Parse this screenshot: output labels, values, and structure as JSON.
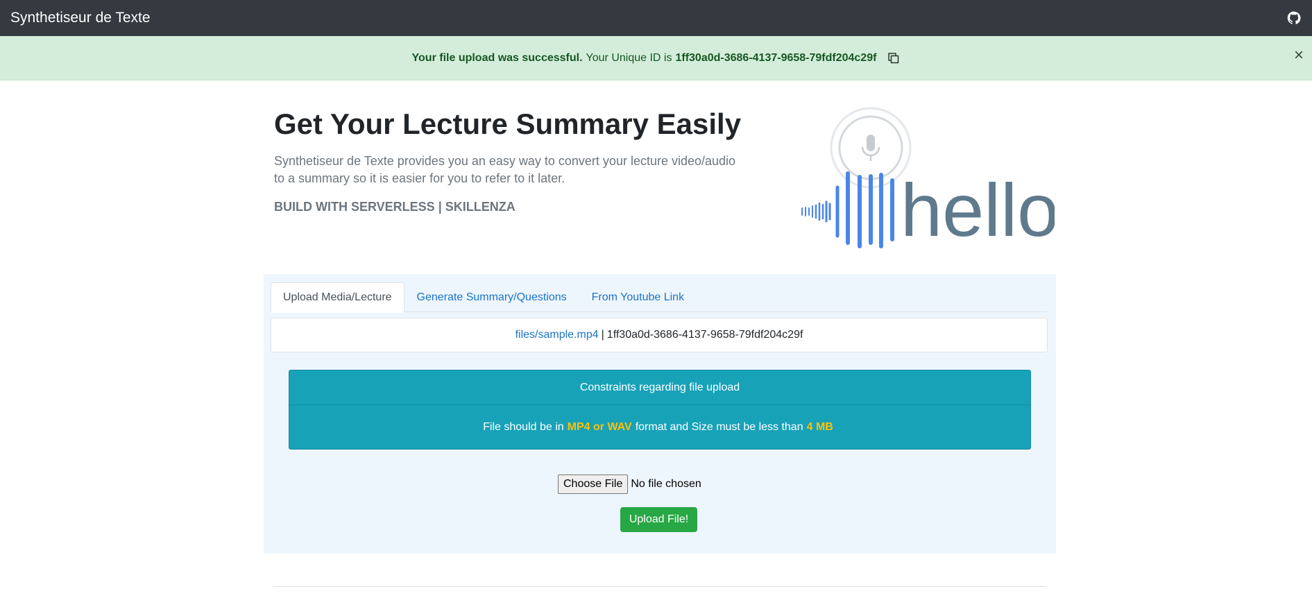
{
  "navbar": {
    "brand": "Synthetiseur de Texte",
    "github_icon": "github-icon"
  },
  "alert": {
    "strong_text": "Your file upload was successful.",
    "text": "Your Unique ID is",
    "unique_id": "1ff30a0d-3686-4137-9658-79fdf204c29f",
    "copy_icon": "copy-icon",
    "close": "×"
  },
  "hero": {
    "title": "Get Your Lecture Summary Easily",
    "lead": "Synthetiseur de Texte provides you an easy way to convert your lecture video/audio to a summary so it is easier for you to refer to it later.",
    "credit": "BUILD WITH SERVERLESS | SKILLENZA",
    "art_word": "hello",
    "art_icon": "microphone-icon"
  },
  "tabs": [
    {
      "label": "Upload Media/Lecture",
      "active": true
    },
    {
      "label": "Generate Summary/Questions",
      "active": false
    },
    {
      "label": "From Youtube Link",
      "active": false
    }
  ],
  "upload_status": {
    "file_path": "files/sample.mp4",
    "separator": "|",
    "file_id": "1ff30a0d-3686-4137-9658-79fdf204c29f"
  },
  "constraints": {
    "header": "Constraints regarding file upload",
    "body_prefix": "File should be in",
    "formats": "MP4 or WAV",
    "body_middle": "format and Size must be less than",
    "size_limit": "4 MB"
  },
  "file_input": {
    "button_label": "Choose File",
    "status": "No file chosen"
  },
  "upload_button": "Upload File!",
  "colors": {
    "navbar": "#343a40",
    "alert_bg": "#d4edda",
    "alert_text": "#155724",
    "link": "#1a73c9",
    "info": "#17a2b8",
    "highlight": "#ffc107",
    "success": "#28a745",
    "panel_bg": "#eef6fd",
    "art_blue": "#4a86e8",
    "art_gray": "#5f7a8c"
  }
}
